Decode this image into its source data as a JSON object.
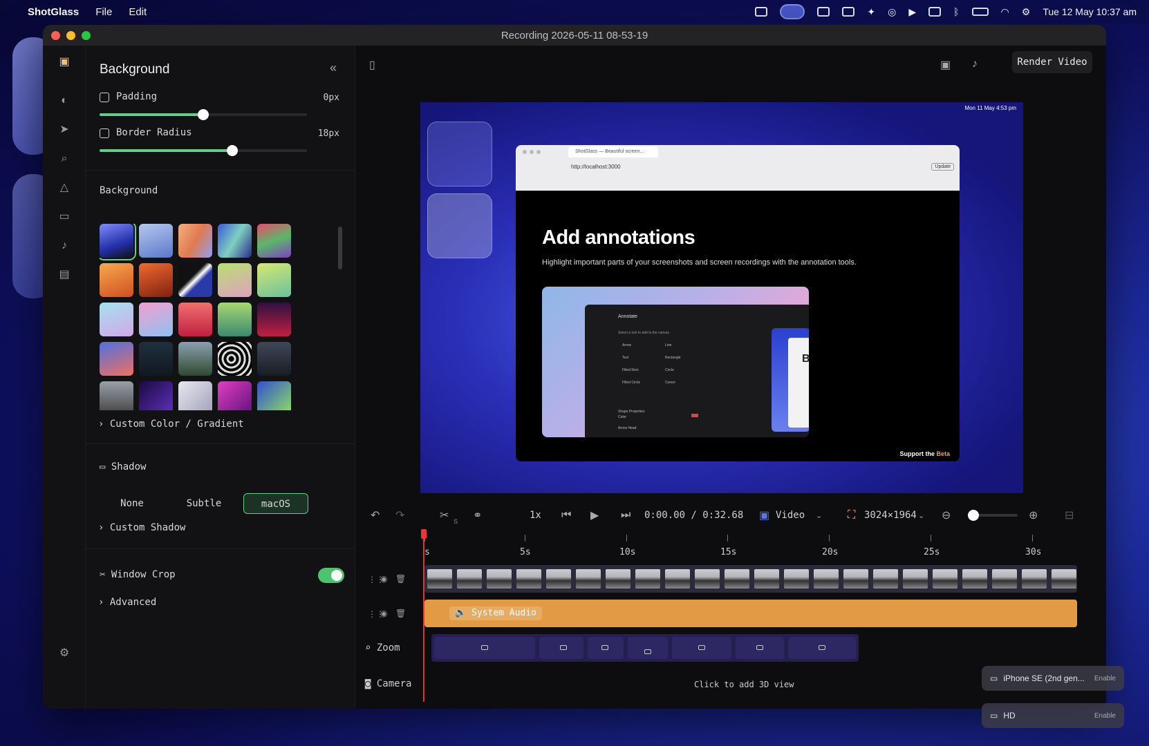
{
  "menubar": {
    "app_name": "ShotGlass",
    "menus": [
      "File",
      "Edit"
    ],
    "datetime": "Tue 12 May  10:37 am"
  },
  "window": {
    "title": "Recording 2026-05-11 08-53-19"
  },
  "panel": {
    "title": "Background",
    "padding_label": "Padding",
    "padding_value": "0px",
    "padding_slider": 0.5,
    "border_radius_label": "Border Radius",
    "border_radius_value": "18px",
    "border_radius_slider": 0.64,
    "background_section": "Background",
    "custom_color": "Custom Color / Gradient",
    "shadow_section": "Shadow",
    "shadow_options": [
      "None",
      "Subtle",
      "macOS"
    ],
    "shadow_selected": "macOS",
    "custom_shadow": "Custom Shadow",
    "window_crop": "Window Crop",
    "window_crop_enabled": true,
    "advanced": "Advanced"
  },
  "toolbar": {
    "render_label": "Render Video",
    "speed": "1x",
    "time": "0:00.00 / 0:32.68",
    "source": "Video",
    "resolution": "3024×1964",
    "cut_shortcut": "S"
  },
  "preview": {
    "menubar_datetime": "Mon 11 May  4:53 pm",
    "tab_title": "ShotGlass — Beautiful screen...",
    "url": "http://localhost:3000",
    "update_label": "Update",
    "heading": "Add annotations",
    "paragraph": "Highlight important parts of your screenshots and screen recordings with the annotation tools.",
    "support_text": "Support the ",
    "support_link": "Beta",
    "inner_panel_title": "Annotate",
    "inner_hint": "Select a tool to add to the canvas",
    "inner_tools": [
      "Arrow",
      "Line",
      "Text",
      "Rectangle",
      "Filled Rect",
      "Circle",
      "Filled Circle",
      "Cursor"
    ],
    "inner_shape_props": "Shape Properties",
    "inner_color": "Color",
    "inner_arrow_head": "Arrow Head",
    "inner_badge": "B"
  },
  "timeline": {
    "ticks": [
      "s",
      "5s",
      "10s",
      "15s",
      "20s",
      "25s",
      "30s"
    ],
    "audio_label": "System Audio",
    "zoom_label": "Zoom",
    "camera_label": "Camera",
    "camera_hint": "Click to add 3D view"
  },
  "devices": [
    {
      "name": "iPhone SE (2nd gen...",
      "action": "Enable"
    },
    {
      "name": "HD",
      "action": "Enable"
    }
  ],
  "colors": {
    "accent": "#5fd08a",
    "audio": "#e29a43",
    "zoom": "#241f4e"
  }
}
